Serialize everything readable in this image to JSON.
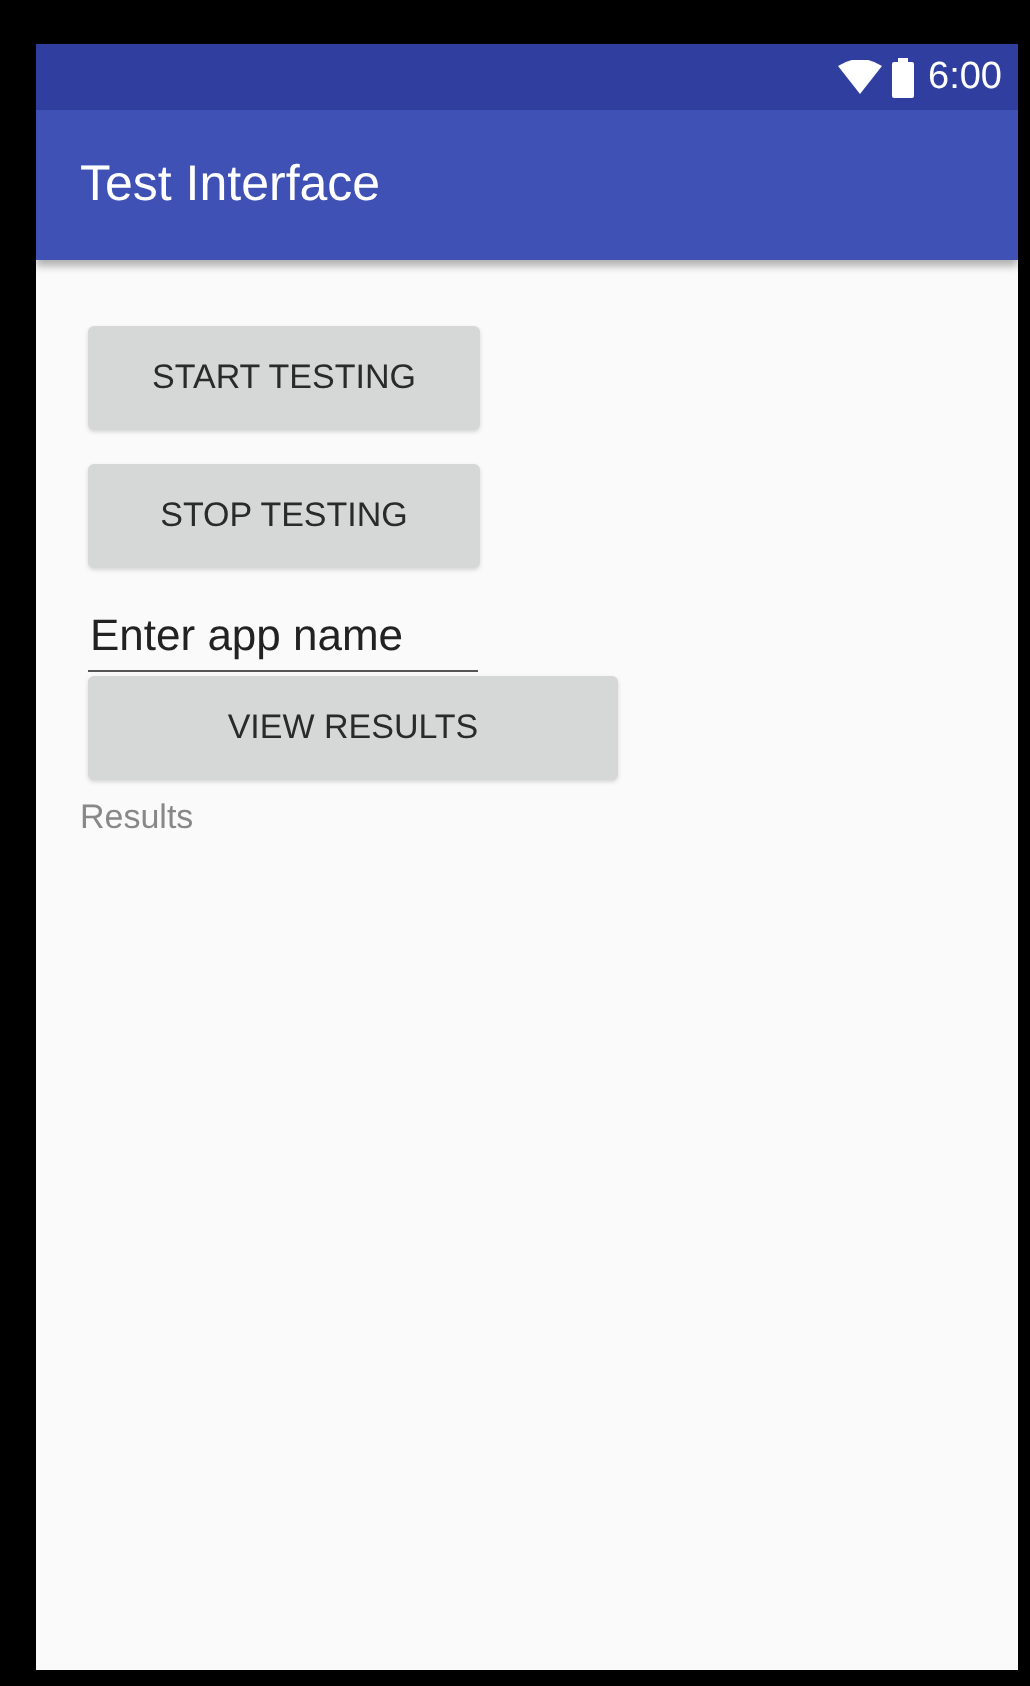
{
  "status_bar": {
    "time": "6:00"
  },
  "app_bar": {
    "title": "Test Interface"
  },
  "buttons": [
    {
      "label": "START TESTING"
    },
    {
      "label": "STOP TESTING"
    }
  ],
  "app_name_field": {
    "value": "Enter app name"
  },
  "view_button": {
    "label": "VIEW RESULTS"
  },
  "results_label": "Results"
}
